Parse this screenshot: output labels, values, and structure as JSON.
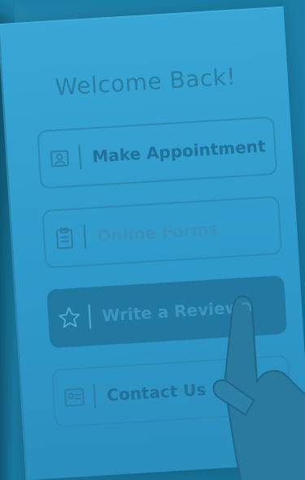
{
  "header": {
    "welcome": "Welcome Back!"
  },
  "menu": {
    "items": [
      {
        "label": "Make Appointment",
        "icon": "appointment-icon"
      },
      {
        "label": "Online Forms",
        "icon": "clipboard-icon"
      },
      {
        "label": "Write a Review",
        "icon": "star-icon"
      },
      {
        "label": "Contact Us",
        "icon": "contact-card-icon"
      }
    ]
  },
  "colors": {
    "overlay": "#2a8fbd",
    "active_button": "#2178a0",
    "text": "#21729a"
  }
}
